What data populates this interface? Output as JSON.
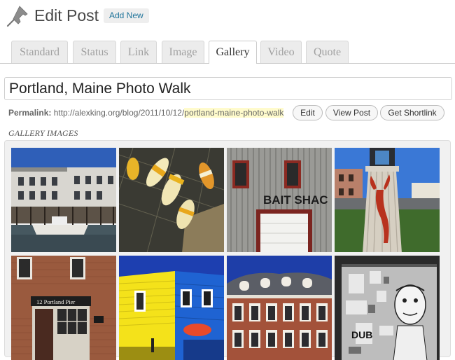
{
  "header": {
    "title": "Edit Post",
    "add_new_label": "Add New"
  },
  "tabs": [
    {
      "label": "Standard",
      "active": false
    },
    {
      "label": "Status",
      "active": false
    },
    {
      "label": "Link",
      "active": false
    },
    {
      "label": "Image",
      "active": false
    },
    {
      "label": "Gallery",
      "active": true
    },
    {
      "label": "Video",
      "active": false
    },
    {
      "label": "Quote",
      "active": false
    }
  ],
  "post": {
    "title": "Portland, Maine Photo Walk"
  },
  "permalink": {
    "label": "Permalink:",
    "base_url": "http://alexking.org/blog/2011/10/12/",
    "slug": "portland-maine-photo-walk",
    "edit_label": "Edit",
    "view_label": "View Post",
    "shortlink_label": "Get Shortlink"
  },
  "gallery": {
    "label": "Gallery Images",
    "images": [
      {
        "name": "wharf-buildings",
        "sign_text": ""
      },
      {
        "name": "lobster-buoys",
        "sign_text": ""
      },
      {
        "name": "bait-shack",
        "sign_text": "BAIT SHAC"
      },
      {
        "name": "lobster-lighthouse",
        "sign_text": ""
      },
      {
        "name": "portland-pier",
        "sign_text": "12  Portland Pier"
      },
      {
        "name": "yellow-blue-houses",
        "sign_text": ""
      },
      {
        "name": "victorian-facade",
        "sign_text": ""
      },
      {
        "name": "bw-posters",
        "sign_text": "DUB"
      }
    ]
  },
  "colors": {
    "link": "#21759b",
    "slug_highlight": "#fffbcc",
    "active_tab_bg": "#ffffff",
    "inactive_tab_bg": "#ececec"
  }
}
